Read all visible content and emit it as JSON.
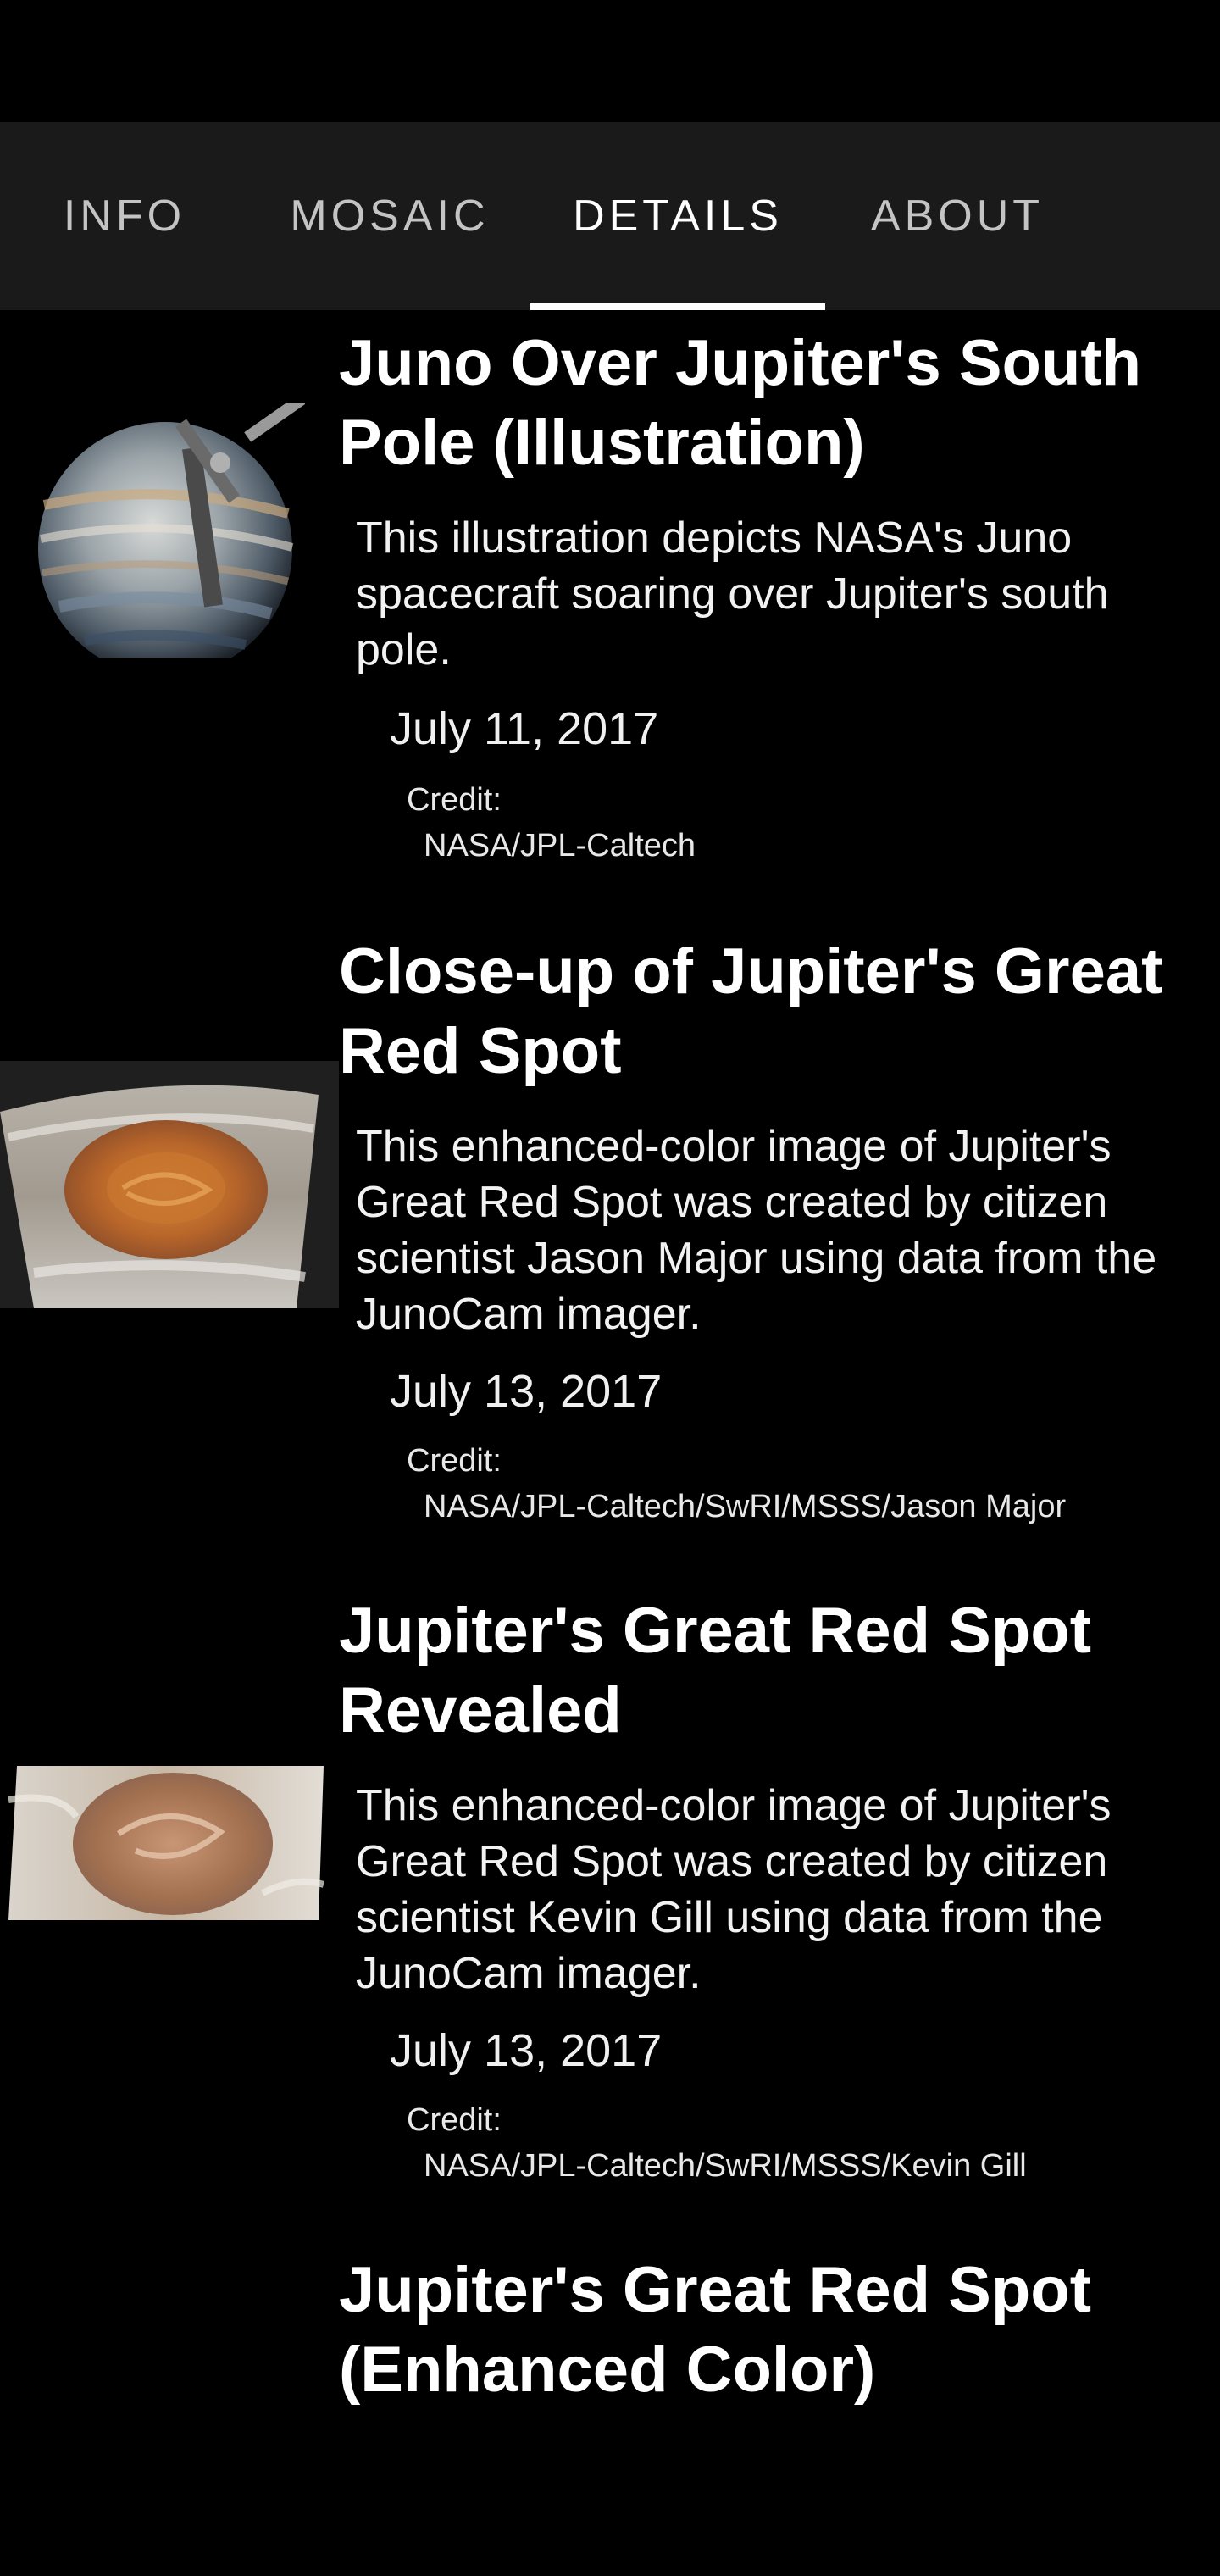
{
  "tabs": [
    {
      "label": "INFO",
      "active": false
    },
    {
      "label": "MOSAIC",
      "active": false
    },
    {
      "label": "DETAILS",
      "active": true
    },
    {
      "label": "ABOUT",
      "active": false
    }
  ],
  "items": [
    {
      "title": "Juno Over Jupiter's South Pole (Illustration)",
      "description": "This illustration depicts NASA's Juno spacecraft soaring over Jupiter's south pole.",
      "date": "July 11, 2017",
      "credit_label": "Credit:",
      "credit": "NASA/JPL-Caltech",
      "thumbnail": "juno-spacecraft-jupiter-illustration"
    },
    {
      "title": "Close-up of Jupiter's Great Red Spot",
      "description": "This enhanced-color image of Jupiter's Great Red Spot was created by citizen scientist Jason Major using data from the JunoCam imager.",
      "date": "July 13, 2017",
      "credit_label": "Credit:",
      "credit": "NASA/JPL-Caltech/SwRI/MSSS/Jason Major",
      "thumbnail": "great-red-spot-closeup"
    },
    {
      "title": "Jupiter's Great Red Spot Revealed",
      "description": "This enhanced-color image of Jupiter's Great Red Spot was created by citizen scientist Kevin Gill using data from the JunoCam imager.",
      "date": "July 13, 2017",
      "credit_label": "Credit:",
      "credit": "NASA/JPL-Caltech/SwRI/MSSS/Kevin Gill",
      "thumbnail": "great-red-spot-revealed"
    },
    {
      "title": "Jupiter's Great Red Spot (Enhanced Color)"
    }
  ]
}
